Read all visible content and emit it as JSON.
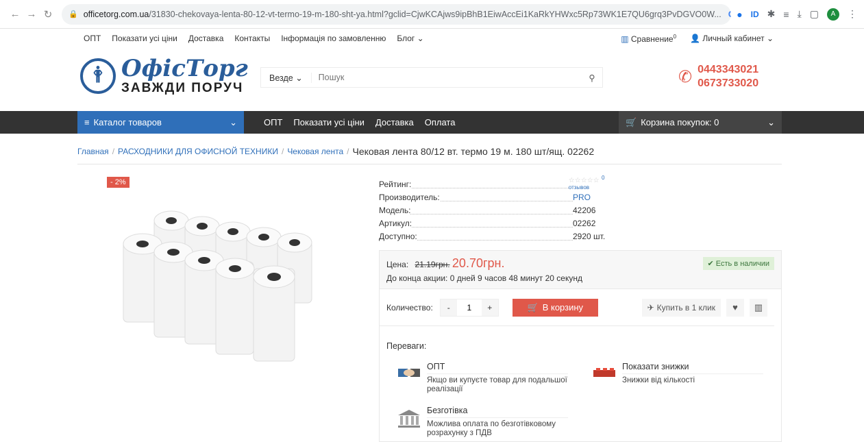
{
  "browser": {
    "host": "officetorg.com.ua",
    "path": "/31830-chekovaya-lenta-80-12-vt-termo-19-m-180-sht-ya.html?gclid=CjwKCAjws9ipBhB1EiwAccEi1KaRkYHWxc5Rp73WK1E7QU6grq3PvDGVO0W...",
    "profile_initial": "A"
  },
  "topbar": {
    "links": [
      "ОПТ",
      "Показати усі ціни",
      "Доставка",
      "Контакты",
      "Інформація по замовленню",
      "Блог ⌄"
    ],
    "compare": "Сравнение",
    "compare_count": "0",
    "account": "Личный кабинет ⌄"
  },
  "header": {
    "logo_name": "ОфісТорг",
    "logo_sub": "ЗАВЖДИ ПОРУЧ",
    "search_scope": "Везде ⌄",
    "search_placeholder": "Пошук",
    "phone1": "0443343021",
    "phone2": "0673733020"
  },
  "navbar": {
    "catalog": "Каталог товаров",
    "links": [
      "ОПТ",
      "Показати усі ціни",
      "Доставка",
      "Оплата"
    ],
    "cart": "Корзина покупок: 0"
  },
  "breadcrumb": {
    "items": [
      "Главная",
      "РАСХОДНИКИ ДЛЯ ОФИСНОЙ ТЕХНИКИ",
      "Чековая лента"
    ],
    "current": "Чековая лента 80/12 вт. термо 19 м. 180 шт/ящ. 02262"
  },
  "product": {
    "discount_badge": "- 2%",
    "specs": [
      {
        "label": "Рейтинг:",
        "value": ""
      },
      {
        "label": "Производитель:",
        "value": "PRO"
      },
      {
        "label": "Модель:",
        "value": "42206"
      },
      {
        "label": "Артикул:",
        "value": "02262"
      },
      {
        "label": "Доступно:",
        "value": "2920 шт."
      }
    ],
    "reviews": "0 отзывов",
    "price_label": "Цена:",
    "old_price": "21.19грн.",
    "new_price": "20.70грн.",
    "promo": "До конца акции: 0 дней 9 часов 48 минут 20 секунд",
    "stock": "✔ Есть в наличии",
    "qty_label": "Количество:",
    "qty_value": "1",
    "buy_label": "В корзину",
    "oneclick_label": "Купить в 1 клик"
  },
  "advantages": {
    "title": "Переваги:",
    "items": [
      {
        "title": "ОПТ",
        "text": "Якщо ви купуєте товар для подальшої реалізації"
      },
      {
        "title": "Показати знижки",
        "text": "Знижки від кількості"
      },
      {
        "title": "Безготівка",
        "text": "Можлива оплата по безготівковому розрахунку з ПДВ"
      }
    ]
  }
}
